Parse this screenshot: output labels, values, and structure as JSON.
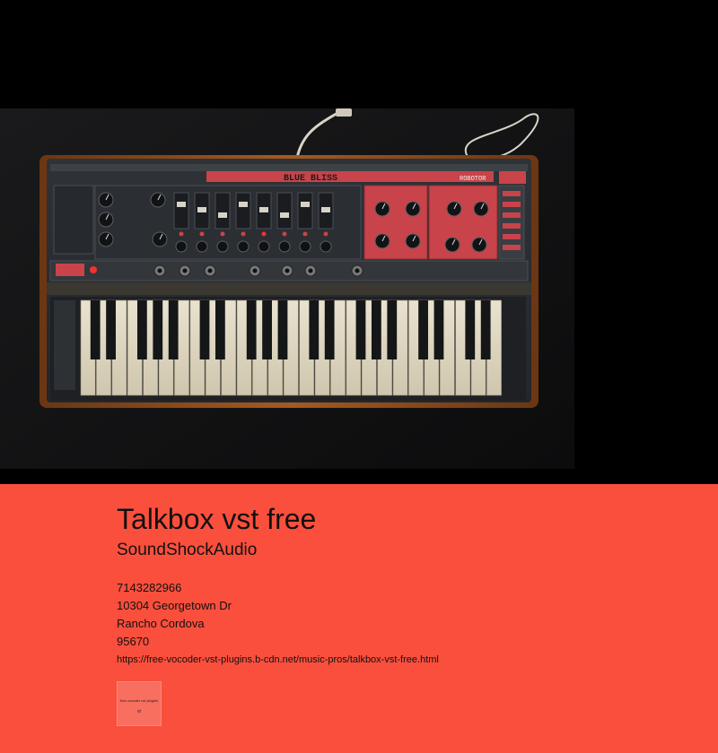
{
  "hero": {
    "image_alt": "vintage red and black synthesizer keyboard",
    "panel_logo_text": "BLUE BLISS",
    "panel_brand_text": "ROBOTOR",
    "colors": {
      "background": "#000000",
      "panel_red": "#c9434a",
      "wood": "#8a4a1c"
    }
  },
  "business": {
    "title": "Talkbox vst free",
    "name": "SoundShockAudio",
    "phone": "7143282966",
    "street": "10304 Georgetown Dr",
    "city": "Rancho Cordova",
    "zip": "95670",
    "url": "https://free-vocoder-vst-plugins.b-cdn.net/music-pros/talkbox-vst-free.html",
    "thumbnail_caption": "free vocoder vst plugins",
    "thumbnail_mark": "vt"
  },
  "colors": {
    "accent": "#fa4f3d",
    "text": "#111111"
  }
}
